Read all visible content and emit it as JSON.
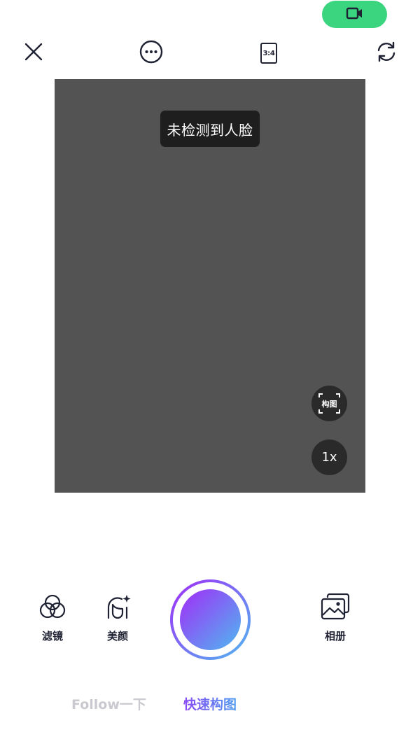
{
  "colors": {
    "video_pill_green": "#3bd47f",
    "preview_background": "#535353",
    "shutter_gradient_start": "#a22cf7",
    "shutter_gradient_end": "#4fb8f0",
    "active_mode_start": "#8a4af3",
    "active_mode_end": "#4f9bef",
    "inactive_mode": "#c9c9cf"
  },
  "header": {
    "video_mode_icon": "video-camera-icon"
  },
  "toolbar": {
    "close_icon": "close-icon",
    "more_icon": "more-options-icon",
    "ratio_label": "3:4",
    "switch_camera_icon": "switch-camera-icon"
  },
  "preview": {
    "toast_text": "未检测到人脸",
    "compose_label": "构图",
    "zoom_label": "1x"
  },
  "bottom": {
    "filter_label": "滤镜",
    "beauty_label": "美颜",
    "album_label": "相册"
  },
  "modes": {
    "follow_label": "Follow一下",
    "quick_compose_label": "快速构图",
    "active": "快速构图"
  }
}
